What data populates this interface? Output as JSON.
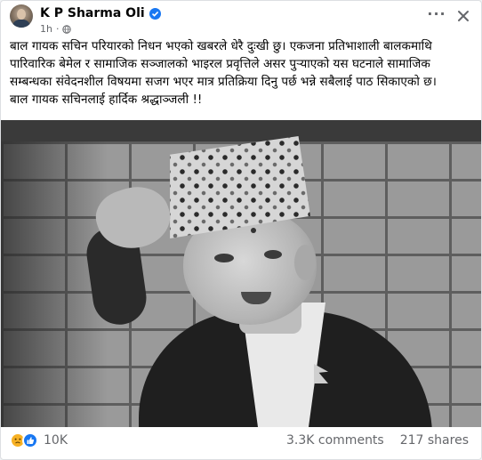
{
  "post": {
    "author": "K P Sharma Oli",
    "time": "1h",
    "more_label": "···",
    "text_lines": [
      "बाल गायक सचिन परियारको निधन भएको खबरले धेरै दुःखी छु। एकजना प्रतिभाशाली बालकमाथि",
      "पारिवारिक बेमेल र सामाजिक सञ्जालको भाइरल प्रवृत्तिले असर पुर्‍याएको यस घटनाले सामाजिक",
      "सम्बन्धका संवेदनशील विषयमा सजग भएर मात्र प्रतिक्रिया दिनु पर्छ भन्ने सबैलाई पाठ सिकाएको छ।",
      "बाल गायक सचिनलाई हार्दिक श्रद्धाञ्जली !!"
    ]
  },
  "footer": {
    "reaction_count": "10K",
    "comments": "3.3K comments",
    "shares": "217 shares"
  },
  "colors": {
    "accent": "#1877f2",
    "secondary_text": "#65676b",
    "sad_reaction": "#f7b125"
  },
  "icons": {
    "verified": "verified-badge-icon",
    "privacy": "globe-icon",
    "close": "close-icon",
    "reaction_sad": "sad-reaction-icon",
    "reaction_like": "like-reaction-icon"
  }
}
